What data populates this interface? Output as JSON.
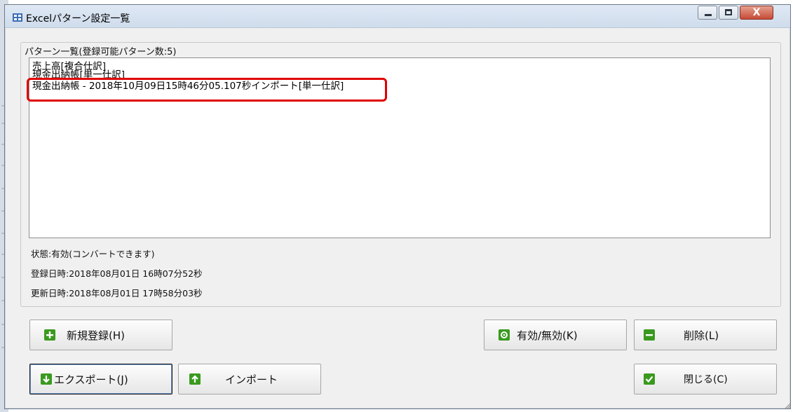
{
  "window": {
    "title": "Excelパターン設定一覧",
    "close_glyph": "X"
  },
  "group": {
    "legend": "パターン一覧(登録可能パターン数:5)"
  },
  "patterns": [
    "売上高[複合仕訳]",
    "現金出納帳[単一仕訳]",
    "現金出納帳 - 2018年10月09日15時46分05.107秒インポート[単一仕訳]"
  ],
  "details": {
    "status": "状態:有効(コンバートできます)",
    "registered": "登録日時:2018年08月01日 16時07分52秒",
    "updated": "更新日時:2018年08月01日 17時58分03秒"
  },
  "buttons": {
    "new": "新規登録(H)",
    "toggle": "有効/無効(K)",
    "delete": "削除(L)",
    "export": "エクスポート(J)",
    "import": "インポート",
    "close": "閉じる(C)"
  },
  "icons": {
    "plus": "plus-icon",
    "minus": "minus-icon",
    "gear": "gear-icon",
    "download": "down-arrow-icon",
    "upload": "up-arrow-icon",
    "check": "check-icon"
  },
  "colors": {
    "highlight": "#e00000",
    "icon_green": "#3a9a1f"
  }
}
